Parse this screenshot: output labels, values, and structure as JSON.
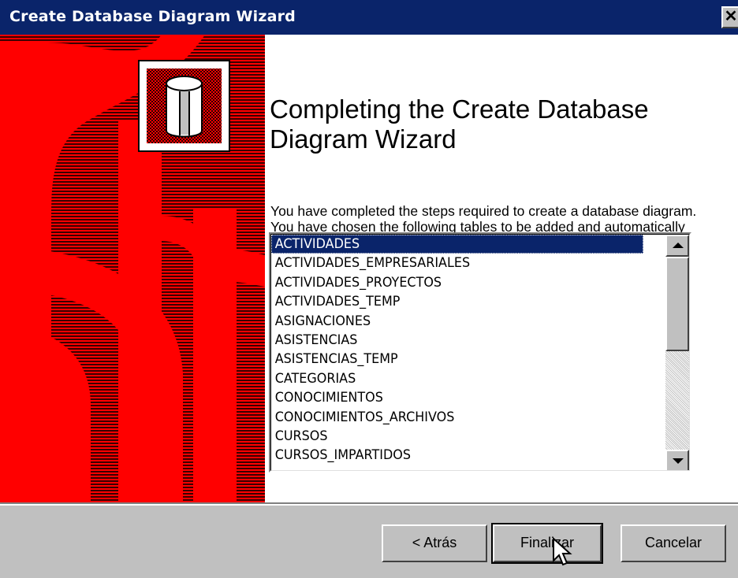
{
  "window": {
    "title": "Create Database Diagram Wizard",
    "close_icon": "close-icon"
  },
  "main": {
    "heading": "Completing the Create Database Diagram Wizard",
    "description": "You have completed the steps required to create a database diagram. You have chosen the following tables to be added and automatically arranged on the diagram:"
  },
  "tables": {
    "selected": "ACTIVIDADES",
    "items": [
      "ACTIVIDADES",
      "ACTIVIDADES_EMPRESARIALES",
      "ACTIVIDADES_PROYECTOS",
      "ACTIVIDADES_TEMP",
      "ASIGNACIONES",
      "ASISTENCIAS",
      "ASISTENCIAS_TEMP",
      "CATEGORIAS",
      "CONOCIMIENTOS",
      "CONOCIMIENTOS_ARCHIVOS",
      "CURSOS",
      "CURSOS_IMPARTIDOS"
    ]
  },
  "buttons": {
    "back": "< Atrás",
    "finish": "Finalizar",
    "cancel": "Cancelar"
  },
  "colors": {
    "title_bar": "#0a246a",
    "selection": "#0a246a",
    "art_red": "#ff0000",
    "art_dark": "#5a0000"
  }
}
